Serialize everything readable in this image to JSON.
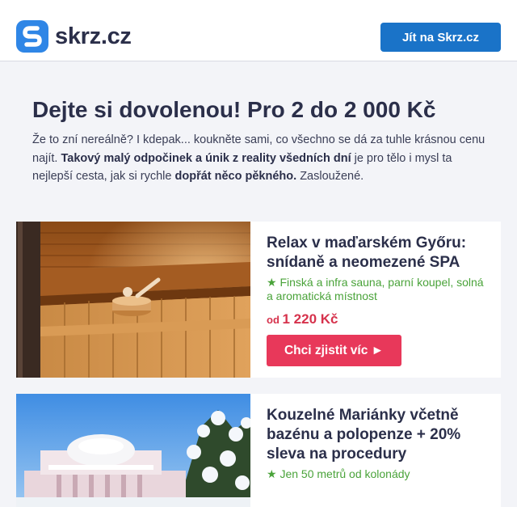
{
  "header": {
    "logo_text": "skrz.cz",
    "cta_label": "Jít na Skrz.cz"
  },
  "intro": {
    "title": "Dejte si dovolenou! Pro 2 do 2 000 Kč",
    "p1": "Že to zní nereálně? I kdepak... koukněte sami, co všechno se dá za tuhle krásnou cenu najít. ",
    "p2": "Takový malý odpočinek a únik z reality všedních dní",
    "p3": " je pro tělo i mysl ta nejlepší cesta, jak si rychle ",
    "p4": "dopřát něco pěkného.",
    "p5": " Zasloužené."
  },
  "offers": [
    {
      "title": "Relax v maďarském Győru: snídaně a neomezené SPA",
      "feature": "★ Finská a infra sauna, parní koupel, solná a aromatická místnost",
      "price_prefix": "od ",
      "price": "1 220 Kč",
      "button": "Chci zjistit víc ►"
    },
    {
      "title": "Kouzelné Mariánky včetně bazénu a polopenze + 20% sleva na procedury",
      "feature": "★ Jen 50 metrů od kolonády"
    }
  ],
  "colors": {
    "brand": "#2f86e6",
    "cta": "#1a73c8",
    "accent": "#e8385a",
    "feature_green": "#4aa33a"
  }
}
